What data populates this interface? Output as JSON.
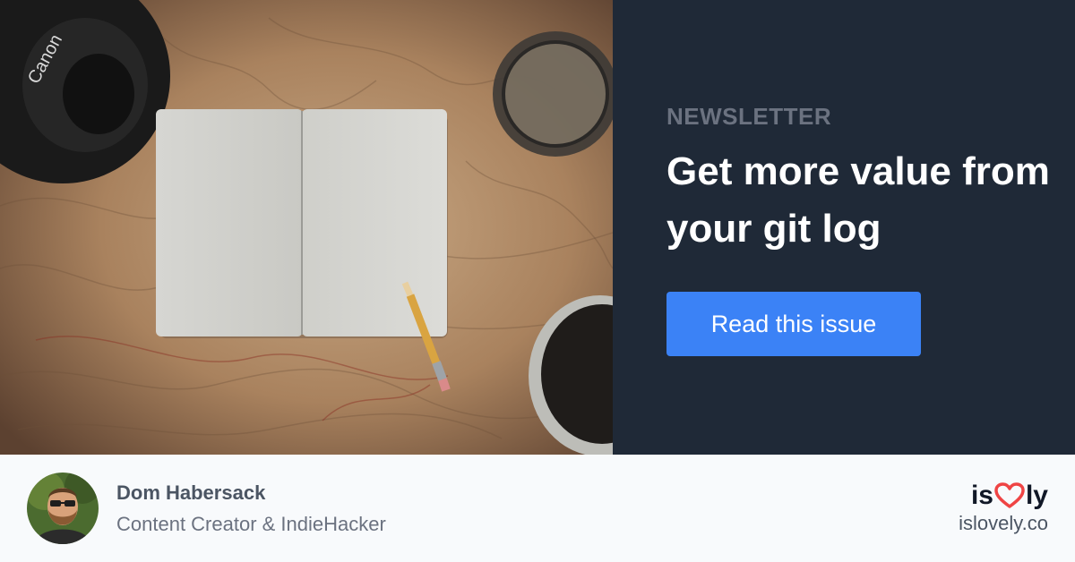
{
  "hero": {
    "eyebrow": "NEWSLETTER",
    "headline": "Get more value from your git log",
    "cta_label": "Read this issue",
    "accent_color": "#3b82f6",
    "panel_color": "#1f2937"
  },
  "author": {
    "name": "Dom Habersack",
    "role": "Content Creator & IndieHacker"
  },
  "brand": {
    "prefix": "is",
    "suffix": "ly",
    "icon": "heart-icon",
    "heart_color": "#ef4444",
    "domain": "islovely.co"
  },
  "photo": {
    "camera_text": "Canon"
  }
}
